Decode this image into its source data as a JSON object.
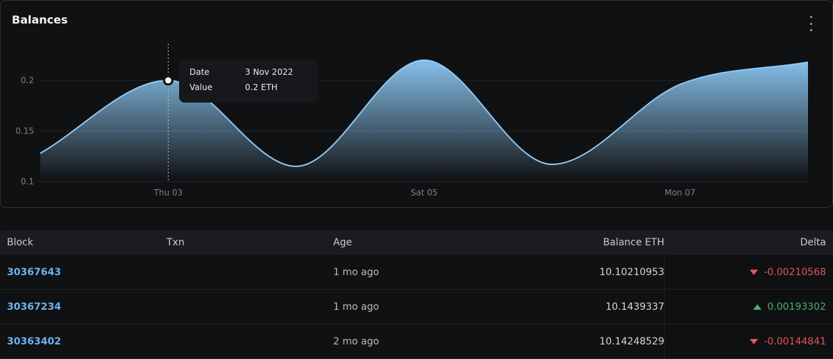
{
  "card": {
    "title": "Balances"
  },
  "chart_data": {
    "type": "area",
    "x": [
      "2022-11-02",
      "2022-11-03",
      "2022-11-04",
      "2022-11-05",
      "2022-11-06",
      "2022-11-07",
      "2022-11-08"
    ],
    "values": [
      0.128,
      0.2,
      0.115,
      0.22,
      0.117,
      0.196,
      0.218
    ],
    "x_ticks": [
      "Thu 03",
      "Sat 05",
      "Mon 07"
    ],
    "y_ticks": [
      "0.1",
      "0.15",
      "0.2"
    ],
    "ylim": [
      0.1,
      0.2
    ],
    "grid": true,
    "line_color": "#8ecaf7",
    "tooltip": {
      "date_label": "Date",
      "date_value": "3 Nov 2022",
      "value_label": "Value",
      "value_value": "0.2 ETH"
    }
  },
  "table": {
    "headers": {
      "block": "Block",
      "txn": "Txn",
      "age": "Age",
      "balance": "Balance ETH",
      "delta": "Delta"
    },
    "rows": [
      {
        "block": "30367643",
        "txn": "",
        "age": "1 mo ago",
        "balance": "10.10210953",
        "delta": "-0.00210568",
        "direction": "down"
      },
      {
        "block": "30367234",
        "txn": "",
        "age": "1 mo ago",
        "balance": "10.1439337",
        "delta": "0.00193302",
        "direction": "up"
      },
      {
        "block": "30363402",
        "txn": "",
        "age": "2 mo ago",
        "balance": "10.14248529",
        "delta": "-0.00144841",
        "direction": "down"
      }
    ]
  }
}
